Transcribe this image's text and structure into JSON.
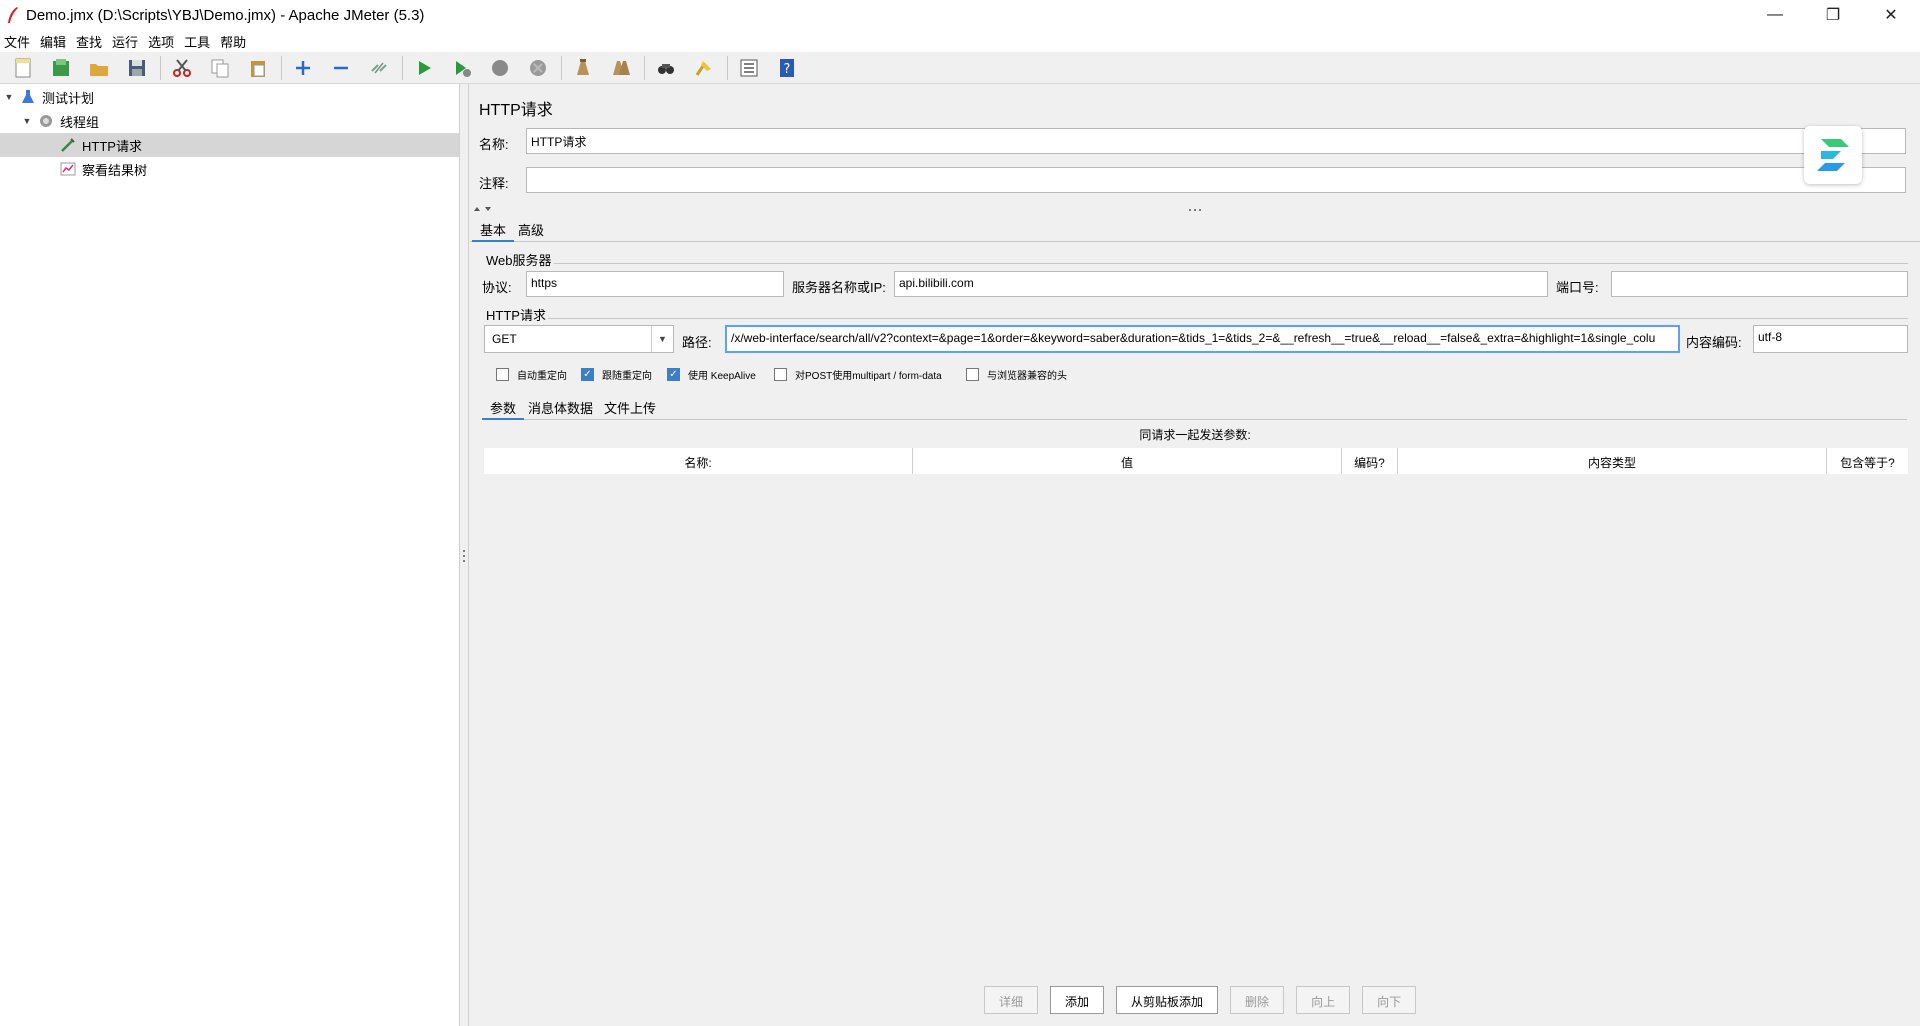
{
  "window": {
    "title": "Demo.jmx (D:\\Scripts\\YBJ\\Demo.jmx) - Apache JMeter (5.3)",
    "minimize": "—",
    "maximize": "❐",
    "close": "✕"
  },
  "menu": [
    "文件",
    "编辑",
    "查找",
    "运行",
    "选项",
    "工具",
    "帮助"
  ],
  "toolbar": {
    "icons": [
      "new-icon",
      "templates-icon",
      "open-icon",
      "save-icon",
      "cut-icon",
      "copy-icon",
      "paste-icon",
      "expand-icon",
      "collapse-icon",
      "toggle-icon",
      "start-icon",
      "start-no-pause-icon",
      "stop-icon",
      "shutdown-icon",
      "clear-icon",
      "clear-all-icon",
      "search-icon",
      "reset-search-icon",
      "function-helper-icon",
      "help-icon"
    ]
  },
  "tree": [
    {
      "label": "测试计划",
      "icon": "test-plan-icon",
      "expanded": true
    },
    {
      "label": "线程组",
      "icon": "thread-group-icon",
      "expanded": true
    },
    {
      "label": "HTTP请求",
      "icon": "http-sampler-icon",
      "selected": true
    },
    {
      "label": "察看结果树",
      "icon": "results-tree-icon"
    }
  ],
  "panel": {
    "title": "HTTP请求",
    "name_label": "名称:",
    "name_value": "HTTP请求",
    "comment_label": "注释:",
    "comment_value": "",
    "tabs": [
      "基本",
      "高级"
    ],
    "web_server": {
      "group_label": "Web服务器",
      "protocol_label": "协议:",
      "protocol_value": "https",
      "server_label": "服务器名称或IP:",
      "server_value": "api.bilibili.com",
      "port_label": "端口号:",
      "port_value": ""
    },
    "http_request": {
      "group_label": "HTTP请求",
      "method": "GET",
      "path_label": "路径:",
      "path_value": "/x/web-interface/search/all/v2?context=&page=1&order=&keyword=saber&duration=&tids_1=&tids_2=&__refresh__=true&__reload__=false&_extra=&highlight=1&single_colu",
      "encoding_label": "内容编码:",
      "encoding_value": "utf-8"
    },
    "checkboxes": [
      {
        "label": "自动重定向",
        "checked": false
      },
      {
        "label": "跟随重定向",
        "checked": true
      },
      {
        "label": "使用 KeepAlive",
        "checked": true
      },
      {
        "label": "对POST使用multipart / form-data",
        "checked": false
      },
      {
        "label": "与浏览器兼容的头",
        "checked": false
      }
    ],
    "subtabs": [
      "参数",
      "消息体数据",
      "文件上传"
    ],
    "table_caption": "同请求一起发送参数:",
    "columns": [
      "名称:",
      "值",
      "编码?",
      "内容类型",
      "包含等于?"
    ],
    "buttons": [
      {
        "label": "详细",
        "enabled": false
      },
      {
        "label": "添加",
        "enabled": true
      },
      {
        "label": "从剪贴板添加",
        "enabled": true
      },
      {
        "label": "删除",
        "enabled": false
      },
      {
        "label": "向上",
        "enabled": false
      },
      {
        "label": "向下",
        "enabled": false
      }
    ]
  },
  "colors": {
    "accent": "#3c7fc8",
    "focus_border": "#5aa0ff",
    "selected_row": "#d6d6d6"
  }
}
